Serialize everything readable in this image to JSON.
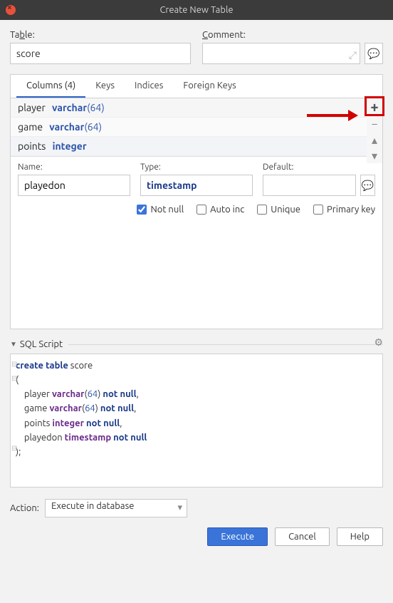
{
  "window": {
    "title": "Create New Table"
  },
  "labels": {
    "table": "Table:",
    "comment": "Comment:",
    "name": "Name:",
    "type": "Type:",
    "default": "Default:",
    "action": "Action:",
    "sql_script": "SQL Script"
  },
  "fields": {
    "table_name": "score",
    "comment": "",
    "col_name": "playedon",
    "col_type": "timestamp",
    "col_default": "",
    "action_select": "Execute in database"
  },
  "tabs": [
    {
      "id": "columns",
      "label": "Columns (4)",
      "active": true
    },
    {
      "id": "keys",
      "label": "Keys",
      "active": false
    },
    {
      "id": "indices",
      "label": "Indices",
      "active": false
    },
    {
      "id": "fkeys",
      "label": "Foreign Keys",
      "active": false
    }
  ],
  "columns": [
    {
      "name": "player",
      "type": "varchar",
      "size": "64"
    },
    {
      "name": "game",
      "type": "varchar",
      "size": "64"
    },
    {
      "name": "points",
      "type": "integer",
      "size": null
    }
  ],
  "checks": {
    "notnull": {
      "label": "Not null",
      "checked": true
    },
    "autoinc": {
      "label": "Auto inc",
      "checked": false
    },
    "unique": {
      "label": "Unique",
      "checked": false
    },
    "pk": {
      "label": "Primary key",
      "checked": false
    }
  },
  "sql": {
    "lines": [
      {
        "t": "create table",
        "rest": " score",
        "cls": "kw"
      },
      {
        "t": "(",
        "cls": "pn"
      },
      {
        "indent": "    ",
        "name": "player",
        "type": "varchar",
        "size": "64",
        "nn": true,
        "comma": true
      },
      {
        "indent": "    ",
        "name": "game",
        "type": "varchar",
        "size": "64",
        "nn": true,
        "comma": true
      },
      {
        "indent": "    ",
        "name": "points",
        "type": "integer",
        "nn": true,
        "comma": true
      },
      {
        "indent": "    ",
        "name": "playedon",
        "type": "timestamp",
        "nn": true,
        "comma": false
      },
      {
        "t": ");",
        "cls": "pn"
      }
    ]
  },
  "buttons": {
    "execute": "Execute",
    "cancel": "Cancel",
    "help": "Help"
  }
}
